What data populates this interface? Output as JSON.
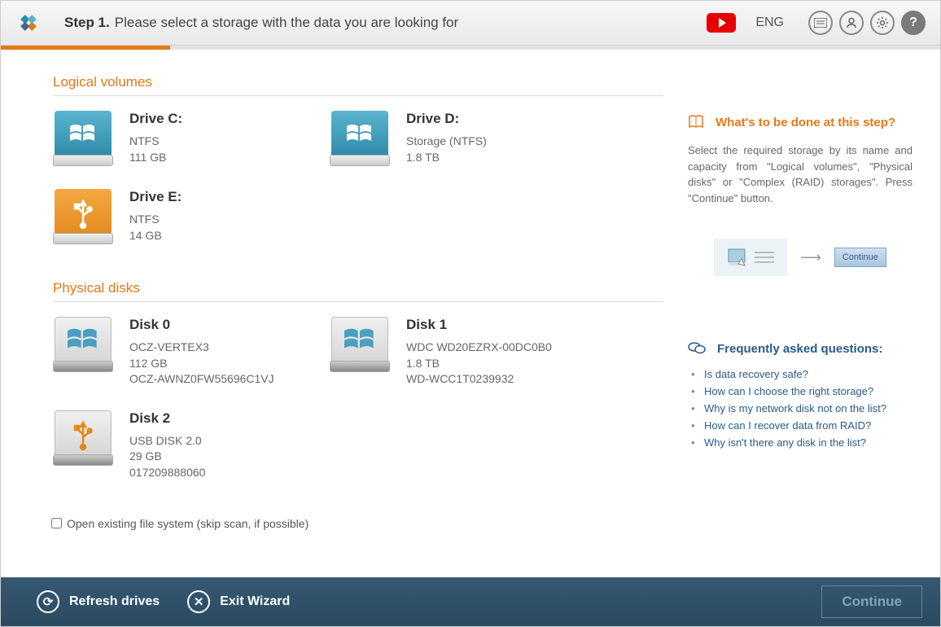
{
  "header": {
    "step_label": "Step 1.",
    "step_desc": "Please select a storage with the data you are looking for",
    "lang": "ENG"
  },
  "sections": {
    "logical": "Logical volumes",
    "physical": "Physical disks"
  },
  "logical_volumes": [
    {
      "title": "Drive C:",
      "fs": "NTFS",
      "size": "111 GB",
      "icon": "win"
    },
    {
      "title": "Drive D:",
      "fs": "Storage (NTFS)",
      "size": "1.8 TB",
      "icon": "win"
    },
    {
      "title": "Drive E:",
      "fs": "NTFS",
      "size": "14 GB",
      "icon": "usb"
    }
  ],
  "physical_disks": [
    {
      "title": "Disk 0",
      "l1": "OCZ-VERTEX3",
      "l2": "112 GB",
      "l3": "OCZ-AWNZ0FW55696C1VJ"
    },
    {
      "title": "Disk 1",
      "l1": "WDC WD20EZRX-00DC0B0",
      "l2": "1.8 TB",
      "l3": "WD-WCC1T0239932"
    },
    {
      "title": "Disk 2",
      "l1": "USB DISK 2.0",
      "l2": "29 GB",
      "l3": "017209888060",
      "usb": true
    }
  ],
  "checkbox_label": "Open existing file system (skip scan, if possible)",
  "help": {
    "title": "What's to be done at this step?",
    "text": "Select the required storage by its name and capacity from \"Logical volumes\", \"Physical disks\" or \"Complex (RAID) storages\". Press \"Continue\" button.",
    "continue_mini": "Continue"
  },
  "faq": {
    "title": "Frequently asked questions:",
    "items": [
      "Is data recovery safe?",
      "How can I choose the right storage?",
      "Why is my network disk not on the list?",
      "How can I recover data from RAID?",
      "Why isn't there any disk in the list?"
    ]
  },
  "footer": {
    "refresh": "Refresh drives",
    "exit": "Exit Wizard",
    "continue": "Continue"
  }
}
